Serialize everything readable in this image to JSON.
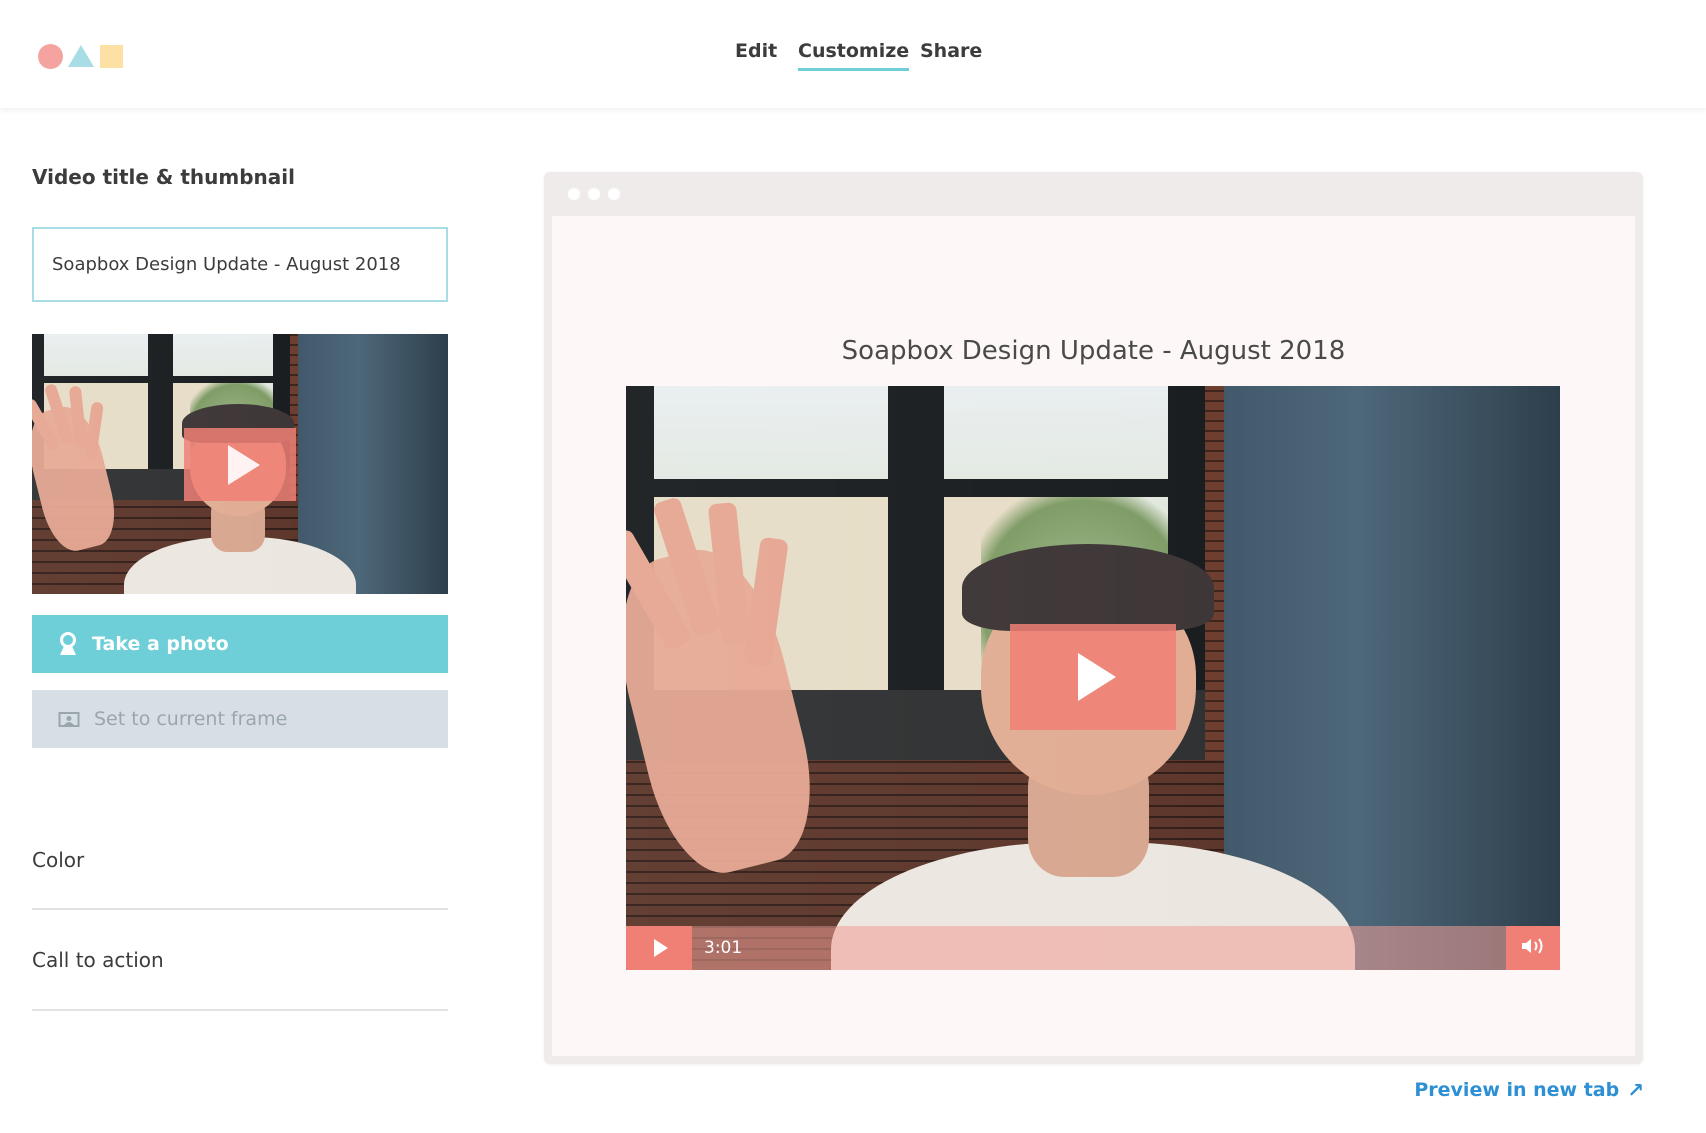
{
  "header": {
    "logo_icon": "shapes-logo",
    "tabs": [
      {
        "label": "Edit",
        "active": false
      },
      {
        "label": "Customize",
        "active": true
      },
      {
        "label": "Share",
        "active": false
      }
    ],
    "active_color": "#6fcfd9"
  },
  "sidebar": {
    "section_title": "Video title & thumbnail",
    "title_input": {
      "value": "Soapbox Design Update - August 2018"
    },
    "thumbnail": {
      "play_icon": "play-icon"
    },
    "take_photo_button": {
      "label": "Take a photo",
      "icon": "user-pin-icon",
      "color": "#6fcfd9"
    },
    "set_frame_button": {
      "label": "Set to current frame",
      "icon": "image-frame-icon",
      "color": "#d8dfe4"
    },
    "accordion": [
      {
        "label": "Color"
      },
      {
        "label": "Call to action"
      }
    ]
  },
  "preview": {
    "video_title": "Soapbox Design Update - August 2018",
    "player": {
      "time": "3:01",
      "play_icon": "play-icon",
      "volume_icon": "volume-icon",
      "accent": "#f08076"
    },
    "link": {
      "label": "Preview in new tab",
      "icon": "external-arrow-icon",
      "color": "#2d8fd4"
    }
  }
}
